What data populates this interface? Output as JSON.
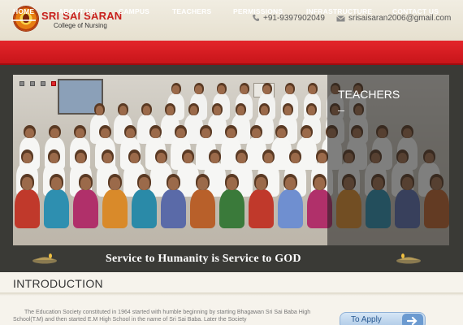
{
  "header": {
    "logo_title": "SRI SAI SARAN",
    "logo_subtitle": "College of Nursing",
    "phone": "+91-9397902049",
    "email": "srisaisaran2006@gmail.com",
    "phone_icon": "phone-icon",
    "mail_icon": "mail-icon"
  },
  "nav": {
    "items": [
      {
        "label": "HOME",
        "active": true
      },
      {
        "label": "ABOUT US"
      },
      {
        "label": "CAMPUS"
      },
      {
        "label": "TEACHERS"
      },
      {
        "label": "PERMISSIONS"
      },
      {
        "label": "INFRASTRUCTURE"
      },
      {
        "label": "CONTACT US"
      }
    ]
  },
  "banner": {
    "panel_title": "TEACHERS",
    "panel_dash": "–",
    "tagline": "Service to Humanity is Service to GOD",
    "slide_count": 4,
    "active_slide": 4
  },
  "intro": {
    "title": "INTRODUCTION",
    "text": "The Education Society constituted in 1964 started with humble beginning by starting Bhagawan Sri Sai Baba High School(T.M) and then started E.M High School in the name of Sri Sai Baba. Later the Society",
    "apply_label": "To Apply"
  },
  "colors": {
    "nav_red": "#d51d22",
    "brand_red": "#c8201c",
    "banner_bg": "#3a3a36",
    "apply_blue": "#2a5a92"
  }
}
